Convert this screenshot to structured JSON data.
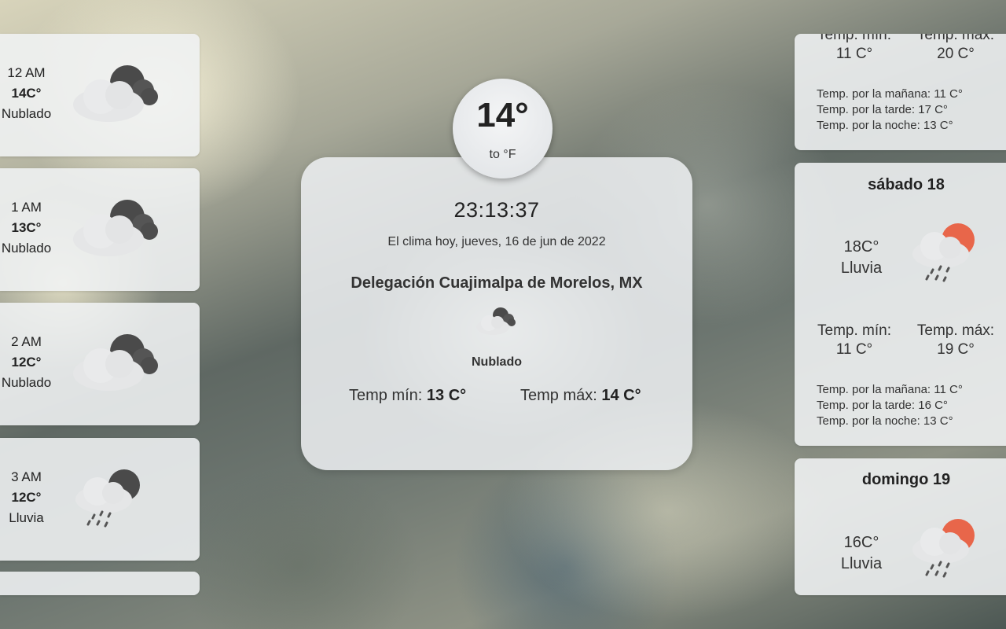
{
  "hourly": [
    {
      "time": "12 AM",
      "temp": "14C°",
      "cond": "Nublado",
      "icon": "cloud-night-icon"
    },
    {
      "time": "1 AM",
      "temp": "13C°",
      "cond": "Nublado",
      "icon": "cloud-night-icon"
    },
    {
      "time": "2 AM",
      "temp": "12C°",
      "cond": "Nublado",
      "icon": "cloud-night-icon"
    },
    {
      "time": "3 AM",
      "temp": "12C°",
      "cond": "Lluvia",
      "icon": "rain-night-icon"
    }
  ],
  "current": {
    "temp": "14°",
    "toggle_label": "to °F",
    "clock": "23:13:37",
    "date": "El clima hoy, jueves, 16 de jun de 2022",
    "location": "Delegación Cuajimalpa de Morelos, MX",
    "condition": "Nublado",
    "icon": "cloud-night-icon",
    "min_label": "Temp mín:",
    "min_value": "13 C°",
    "max_label": "Temp máx:",
    "max_value": "14 C°"
  },
  "daily": [
    {
      "min_label": "Temp. mín:",
      "min": "11 C°",
      "max_label": "Temp. máx:",
      "max": "20 C°",
      "morning": "Temp. por la mañana: 11 C°",
      "afternoon": "Temp. por la tarde: 17 C°",
      "night": "Temp. por la noche: 13 C°"
    },
    {
      "title": "sábado 18",
      "temp": "18C°",
      "cond": "Lluvia",
      "icon": "rain-sun-icon",
      "min_label": "Temp. mín:",
      "min": "11 C°",
      "max_label": "Temp. máx:",
      "max": "19 C°",
      "morning": "Temp. por la mañana: 11 C°",
      "afternoon": "Temp. por la tarde: 16 C°",
      "night": "Temp. por la noche: 13 C°"
    },
    {
      "title": "domingo 19",
      "temp": "16C°",
      "cond": "Lluvia",
      "icon": "rain-sun-icon"
    }
  ],
  "colors": {
    "sun": "#e8664a",
    "moon": "#4a4a4a",
    "cloud": "#e8e9ea",
    "rain": "#555555"
  }
}
